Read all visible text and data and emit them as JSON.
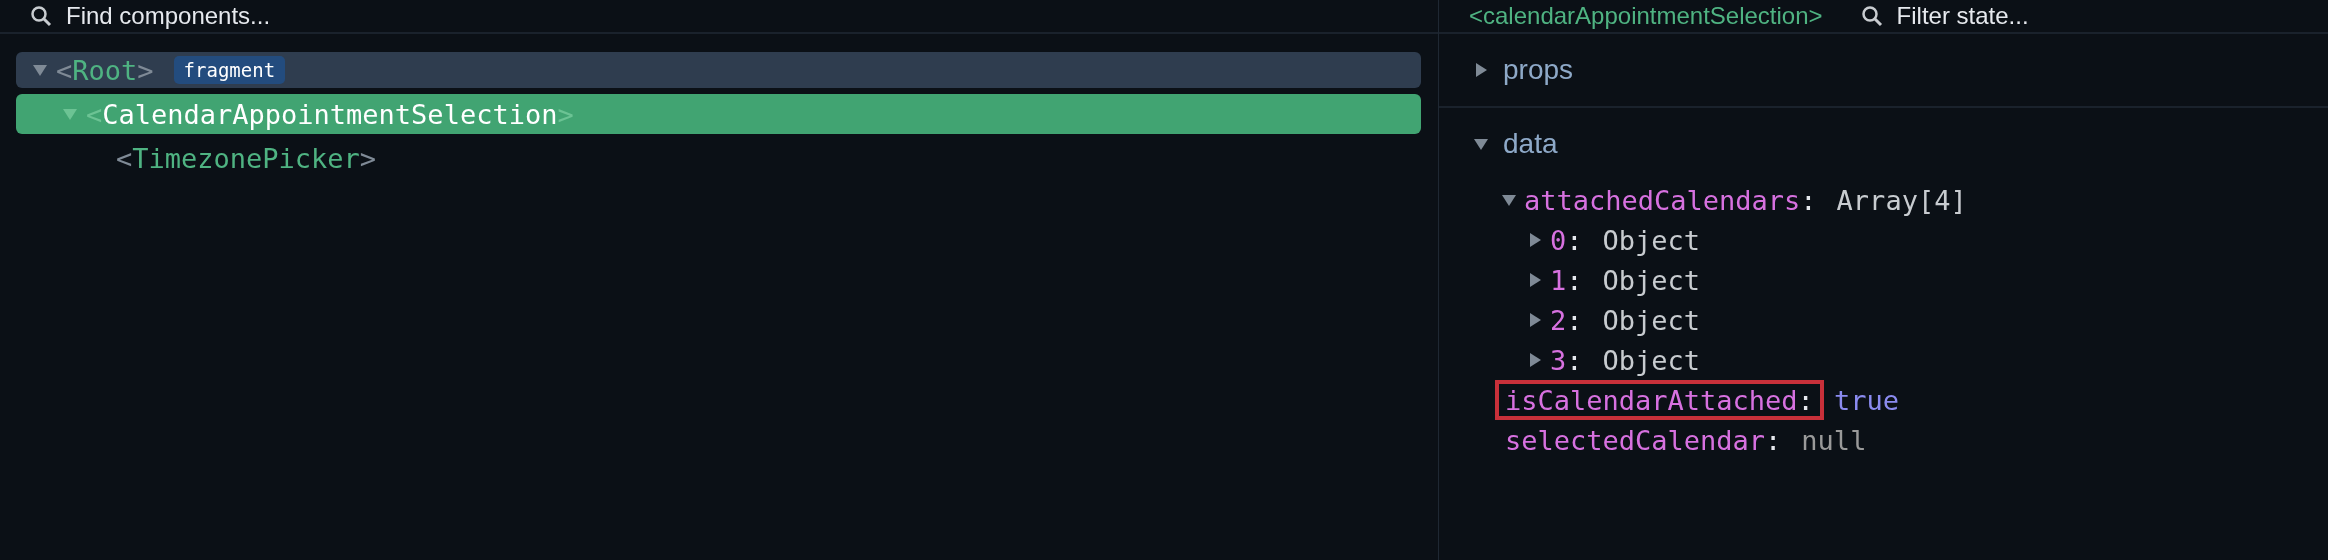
{
  "search": {
    "placeholder": "Find components..."
  },
  "breadcrumb": {
    "open": "<",
    "name": "calendarAppointmentSelection",
    "close": ">"
  },
  "filter": {
    "placeholder": "Filter state..."
  },
  "tree": [
    {
      "open": "<",
      "name": "Root",
      "close": ">",
      "badge": "fragment",
      "expanded": true,
      "selected": false,
      "children": [
        {
          "open": "<",
          "name": "CalendarAppointmentSelection",
          "close": ">",
          "expanded": true,
          "selected": true,
          "children": [
            {
              "open": "<",
              "name": "TimezonePicker",
              "close": ">",
              "selected": false
            }
          ]
        }
      ]
    }
  ],
  "sections": [
    {
      "label": "props",
      "expanded": false
    },
    {
      "label": "data",
      "expanded": true,
      "entries": [
        {
          "key": "attachedCalendars",
          "colon": ":",
          "value": "Array[4]",
          "kind": "plain",
          "expanded": true,
          "children": [
            {
              "key": "0",
              "colon": ":",
              "value": "Object",
              "kind": "plain",
              "expanded": false
            },
            {
              "key": "1",
              "colon": ":",
              "value": "Object",
              "kind": "plain",
              "expanded": false
            },
            {
              "key": "2",
              "colon": ":",
              "value": "Object",
              "kind": "plain",
              "expanded": false
            },
            {
              "key": "3",
              "colon": ":",
              "value": "Object",
              "kind": "plain",
              "expanded": false
            }
          ]
        },
        {
          "key": "isCalendarAttached",
          "colon": ":",
          "value": "true",
          "kind": "boolean",
          "highlighted": true
        },
        {
          "key": "selectedCalendar",
          "colon": ":",
          "value": "null",
          "kind": "null",
          "highlighted": false
        }
      ]
    }
  ]
}
